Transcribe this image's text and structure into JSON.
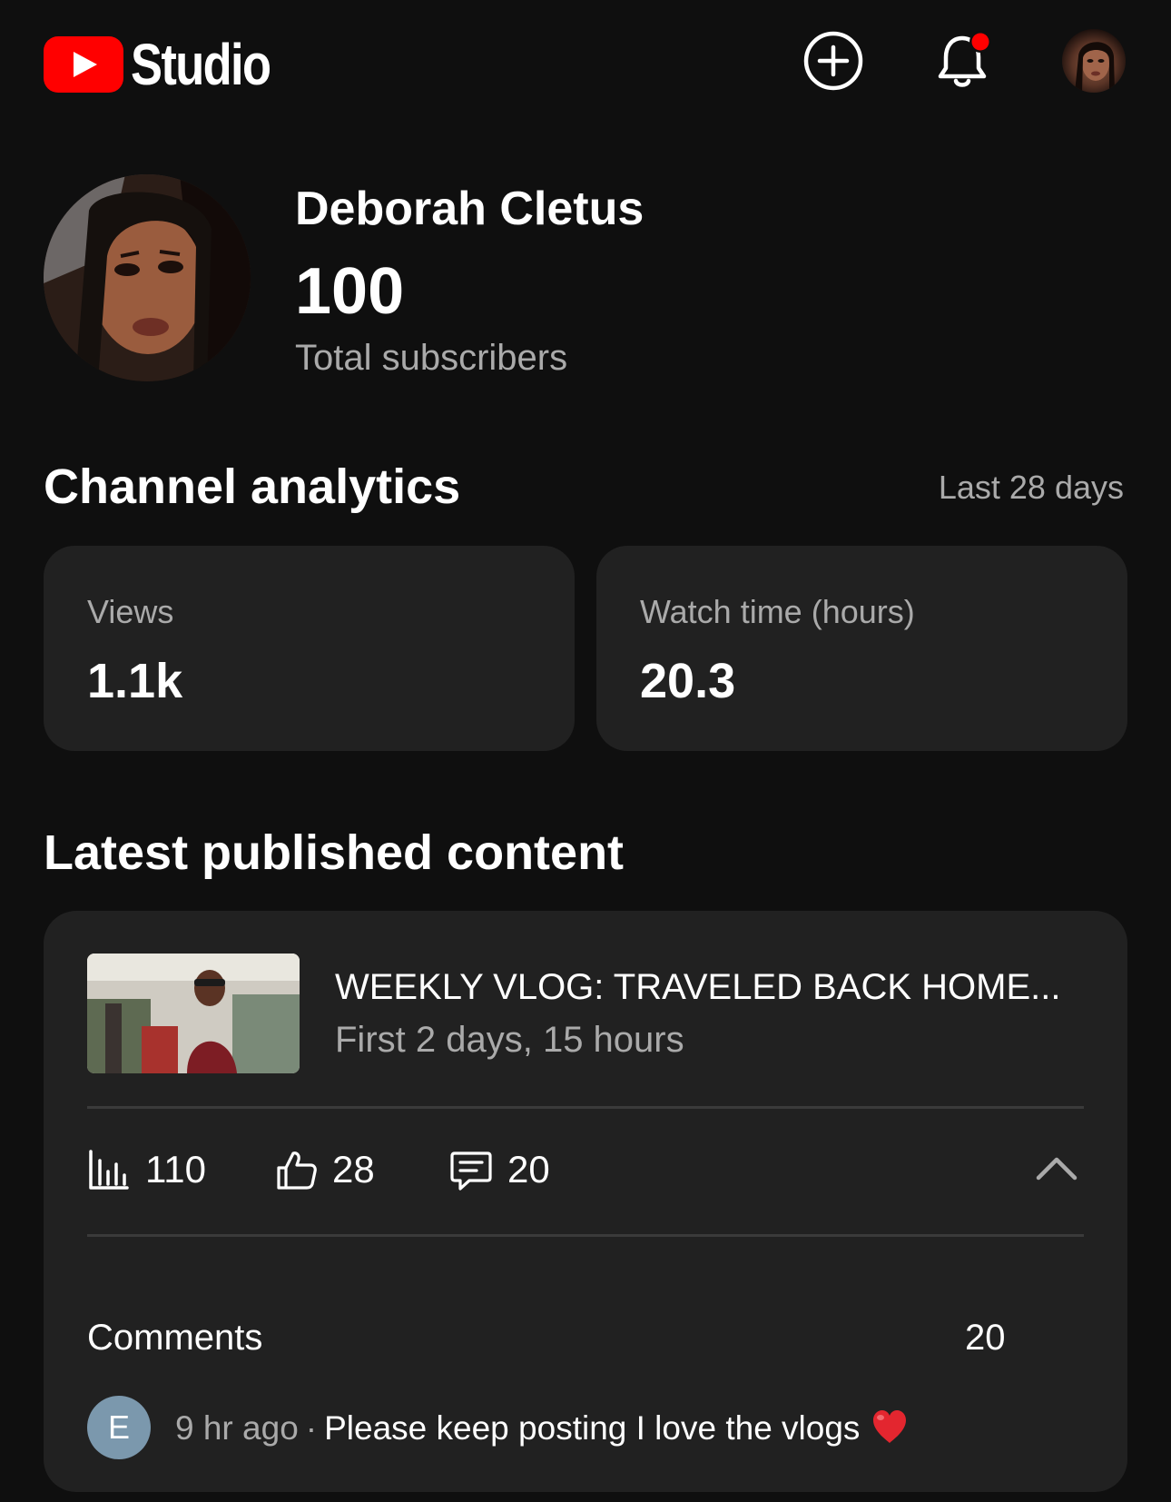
{
  "header": {
    "logo_text": "Studio",
    "icons": [
      "create-icon",
      "notifications-icon",
      "account-avatar"
    ],
    "brand_color": "#ff0000",
    "notification_dot_color": "#ff0000"
  },
  "profile": {
    "channel_name": "Deborah Cletus",
    "subscriber_count": "100",
    "subscriber_label": "Total subscribers"
  },
  "analytics": {
    "title": "Channel analytics",
    "period": "Last 28 days",
    "cards": [
      {
        "label": "Views",
        "value": "1.1k"
      },
      {
        "label": "Watch time (hours)",
        "value": "20.3"
      }
    ]
  },
  "latest": {
    "title": "Latest published content",
    "video_title": "WEEKLY VLOG: TRAVELED BACK HOME...",
    "video_subtitle": "First 2 days, 15 hours",
    "metrics": {
      "views": "110",
      "likes": "28",
      "comments": "20"
    },
    "comments_label": "Comments",
    "comments_count": "20",
    "comment": {
      "avatar_letter": "E",
      "time": "9 hr ago",
      "separator": "·",
      "text": "Please keep posting I love the vlogs",
      "emoji": "heart-icon"
    }
  },
  "colors": {
    "background": "#0f0f0f",
    "card": "#212121",
    "secondary_text": "#aaaaaa",
    "avatar_bg": "#7b98ad"
  }
}
